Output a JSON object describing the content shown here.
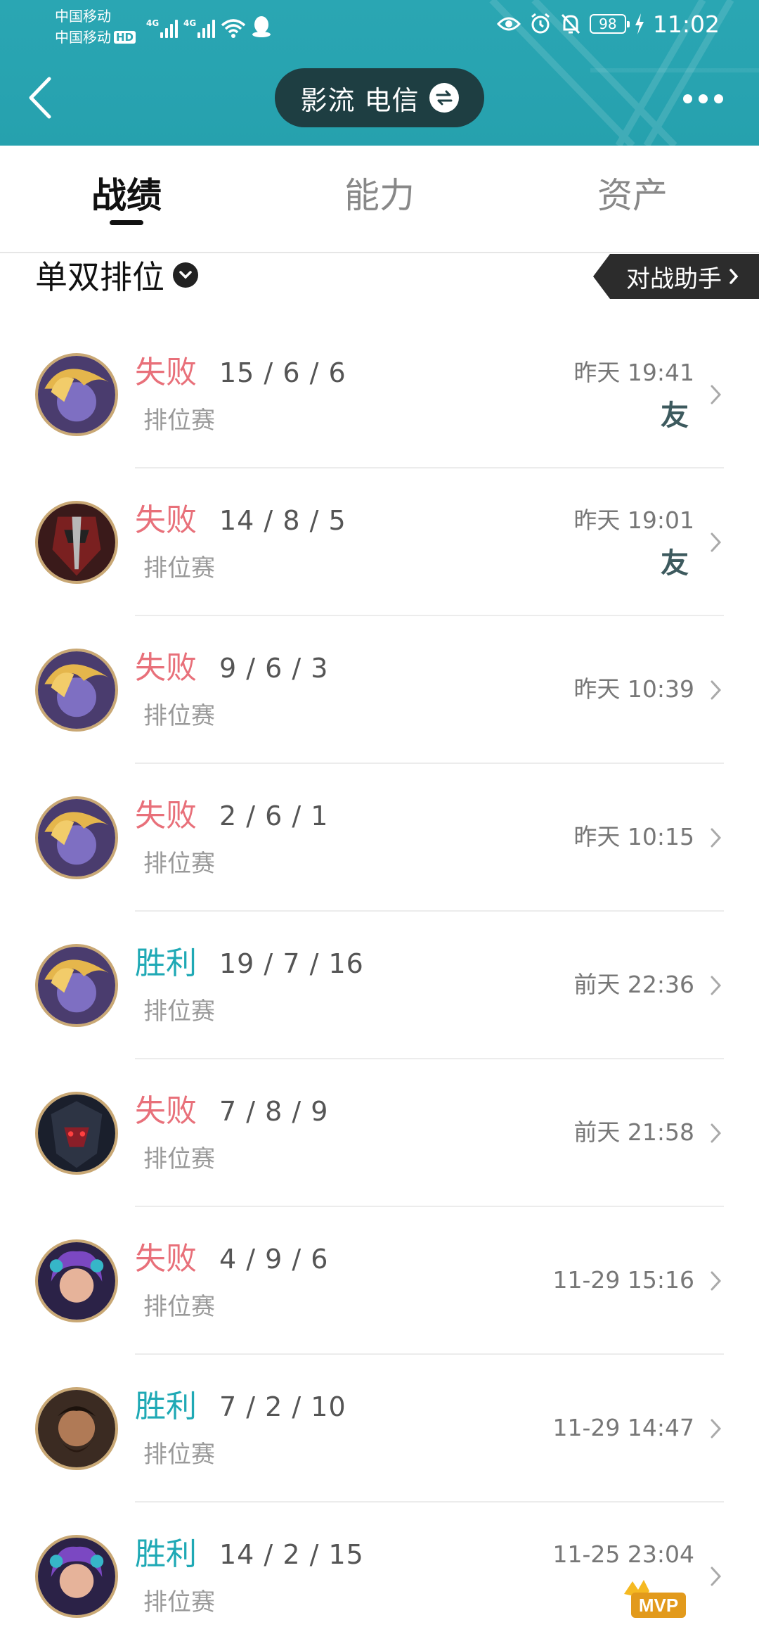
{
  "status_bar": {
    "carrier1": "中国移动",
    "carrier2": "中国移动",
    "hd": "HD",
    "network1": "4G",
    "network2": "4G",
    "battery": "98",
    "time": "11:02"
  },
  "header": {
    "account_name": "影流 电信"
  },
  "tabs": [
    {
      "label": "战绩",
      "active": true
    },
    {
      "label": "能力",
      "active": false
    },
    {
      "label": "资产",
      "active": false
    }
  ],
  "filter": {
    "label": "单双排位",
    "assistant_label": "对战助手"
  },
  "colors": {
    "header": "#2aa6b3",
    "lose": "#e8707a",
    "win": "#1fa9b5",
    "pill": "#1e3e42"
  },
  "matches": [
    {
      "result": "失败",
      "kda": "15 / 6 / 6",
      "mode": "排位赛",
      "time": "昨天 19:41",
      "badge": "友",
      "hero_icon": "hero-blond-icon"
    },
    {
      "result": "失败",
      "kda": "14 / 8 / 5",
      "mode": "排位赛",
      "time": "昨天 19:01",
      "badge": "友",
      "hero_icon": "hero-masked-icon"
    },
    {
      "result": "失败",
      "kda": "9 / 6 / 3",
      "mode": "排位赛",
      "time": "昨天 10:39",
      "badge": "",
      "hero_icon": "hero-blond-icon"
    },
    {
      "result": "失败",
      "kda": "2 / 6 / 1",
      "mode": "排位赛",
      "time": "昨天 10:15",
      "badge": "",
      "hero_icon": "hero-blond-icon"
    },
    {
      "result": "胜利",
      "kda": "19 / 7 / 16",
      "mode": "排位赛",
      "time": "前天 22:36",
      "badge": "",
      "hero_icon": "hero-blond-icon"
    },
    {
      "result": "失败",
      "kda": "7 / 8 / 9",
      "mode": "排位赛",
      "time": "前天 21:58",
      "badge": "",
      "hero_icon": "hero-dark-icon"
    },
    {
      "result": "失败",
      "kda": "4 / 9 / 6",
      "mode": "排位赛",
      "time": "11-29 15:16",
      "badge": "",
      "hero_icon": "hero-purple-hair-icon"
    },
    {
      "result": "胜利",
      "kda": "7 / 2 / 10",
      "mode": "排位赛",
      "time": "11-29 14:47",
      "badge": "",
      "hero_icon": "hero-bearded-icon"
    },
    {
      "result": "胜利",
      "kda": "14 / 2 / 15",
      "mode": "排位赛",
      "time": "11-25 23:04",
      "badge": "MVP",
      "hero_icon": "hero-purple-hair-icon"
    }
  ]
}
